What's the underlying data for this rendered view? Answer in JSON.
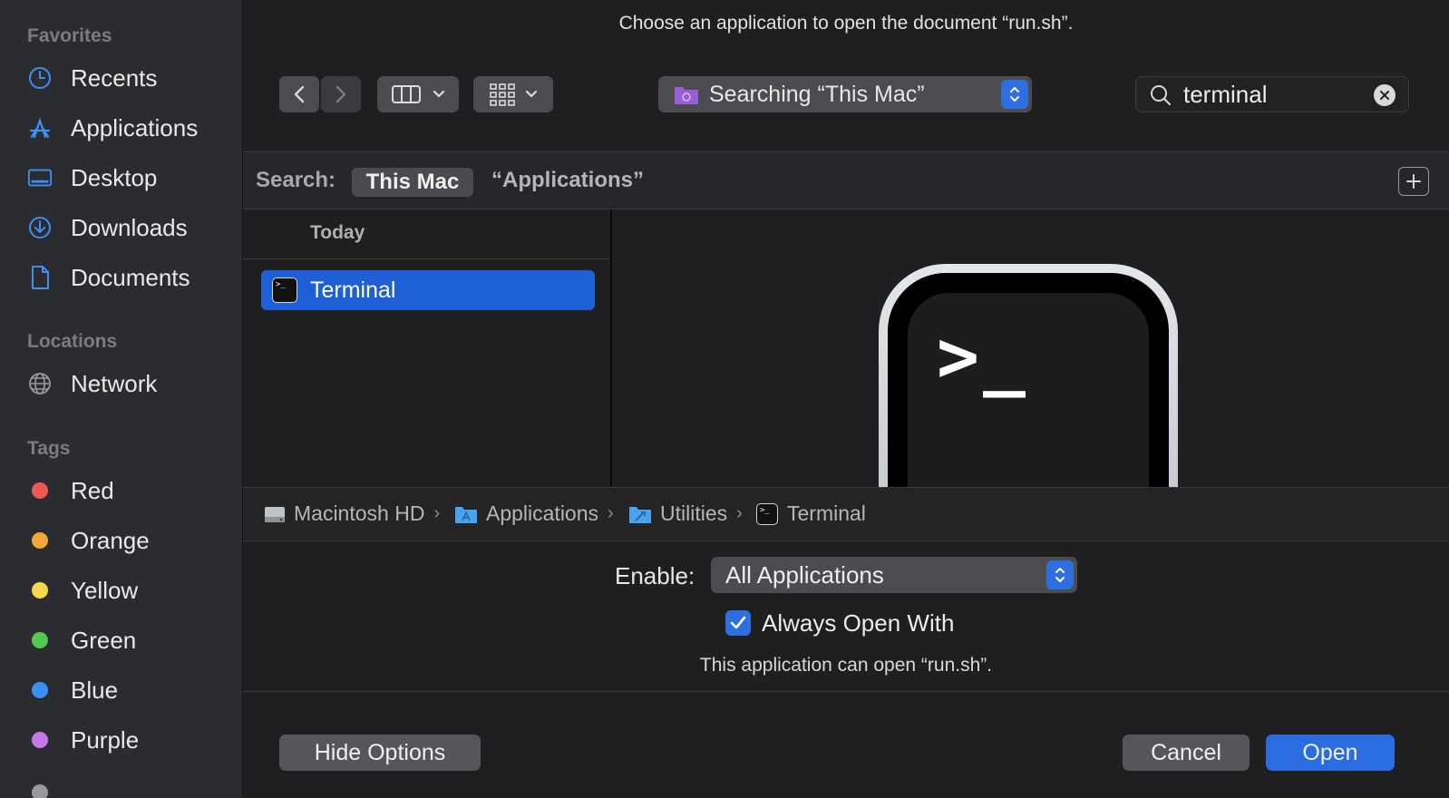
{
  "dialog": {
    "title": "Choose an application to open the document “run.sh”."
  },
  "sidebar": {
    "favorites_label": "Favorites",
    "favorites": [
      {
        "label": "Recents",
        "icon": "clock-icon"
      },
      {
        "label": "Applications",
        "icon": "applications-icon"
      },
      {
        "label": "Desktop",
        "icon": "desktop-icon"
      },
      {
        "label": "Downloads",
        "icon": "downloads-icon"
      },
      {
        "label": "Documents",
        "icon": "document-icon"
      }
    ],
    "locations_label": "Locations",
    "locations": [
      {
        "label": "Network",
        "icon": "globe-icon"
      }
    ],
    "tags_label": "Tags",
    "tags": [
      {
        "label": "Red",
        "color": "#ec5a57"
      },
      {
        "label": "Orange",
        "color": "#f3a93a"
      },
      {
        "label": "Yellow",
        "color": "#f8d64a"
      },
      {
        "label": "Green",
        "color": "#55c84f"
      },
      {
        "label": "Blue",
        "color": "#3b8ef3"
      },
      {
        "label": "Purple",
        "color": "#c477e6"
      }
    ]
  },
  "toolbar": {
    "location_popup": "Searching “This Mac”",
    "search_value": "terminal"
  },
  "scope": {
    "label": "Search:",
    "this_mac": "This Mac",
    "applications": "“Applications”"
  },
  "results": {
    "header": "Today",
    "items": [
      {
        "label": "Terminal",
        "selected": true
      }
    ]
  },
  "path": [
    {
      "label": "Macintosh HD",
      "icon": "hard-drive-icon"
    },
    {
      "label": "Applications",
      "icon": "applications-folder-icon"
    },
    {
      "label": "Utilities",
      "icon": "utilities-folder-icon"
    },
    {
      "label": "Terminal",
      "icon": "terminal-icon"
    }
  ],
  "options": {
    "enable_label": "Enable:",
    "enable_value": "All Applications",
    "always_open_label": "Always Open With",
    "always_open_checked": true,
    "info": "This application can open “run.sh”."
  },
  "buttons": {
    "hide_options": "Hide Options",
    "cancel": "Cancel",
    "open": "Open"
  },
  "colors": {
    "accent": "#2b6de0",
    "selection": "#1f5fd6"
  }
}
